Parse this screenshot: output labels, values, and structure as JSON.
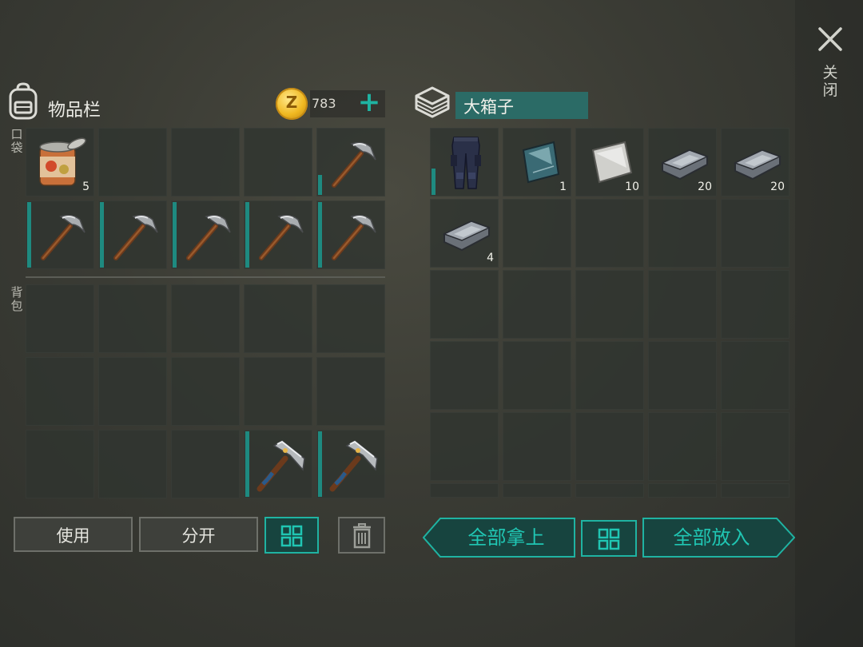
{
  "window": {
    "close_label": "关闭"
  },
  "inventory": {
    "title": "物品栏",
    "currency": "783",
    "coin_symbol": "Z",
    "pocket_label": "口袋",
    "backpack_label": "背包",
    "pocket_slots": [
      {
        "item": "tin-can",
        "count": "5",
        "durability": null
      },
      {
        "item": null
      },
      {
        "item": null
      },
      {
        "item": null
      },
      {
        "item": "pickaxe",
        "count": "",
        "durability": 0.3
      },
      {
        "item": "pickaxe",
        "count": "",
        "durability": 1.0
      },
      {
        "item": "pickaxe",
        "count": "",
        "durability": 1.0
      },
      {
        "item": "pickaxe",
        "count": "",
        "durability": 1.0
      },
      {
        "item": "pickaxe",
        "count": "",
        "durability": 1.0
      },
      {
        "item": "pickaxe",
        "count": "",
        "durability": 1.0
      }
    ],
    "backpack_slots": [
      {
        "item": null
      },
      {
        "item": null
      },
      {
        "item": null
      },
      {
        "item": null
      },
      {
        "item": null
      },
      {
        "item": null
      },
      {
        "item": null
      },
      {
        "item": null
      },
      {
        "item": null
      },
      {
        "item": null
      },
      {
        "item": null
      },
      {
        "item": null
      },
      {
        "item": null
      },
      {
        "item": "iron-pickaxe",
        "count": "",
        "durability": 1.0
      },
      {
        "item": "iron-pickaxe",
        "count": "",
        "durability": 1.0
      }
    ],
    "buttons": {
      "use": "使用",
      "split": "分开"
    }
  },
  "chest": {
    "title": "大箱子",
    "slots": [
      {
        "item": "pants",
        "count": "",
        "durability": 0.4
      },
      {
        "item": "glass-sheet",
        "count": "1"
      },
      {
        "item": "metal-sheet",
        "count": "10"
      },
      {
        "item": "iron-ingot",
        "count": "20"
      },
      {
        "item": "iron-ingot",
        "count": "20"
      },
      {
        "item": "iron-ingot",
        "count": "4"
      }
    ],
    "buttons": {
      "take_all": "全部拿上",
      "put_all": "全部放入"
    }
  },
  "colors": {
    "accent": "#1fb3a2",
    "durability_bar": "#1e8a80",
    "slot": "#30342f"
  }
}
